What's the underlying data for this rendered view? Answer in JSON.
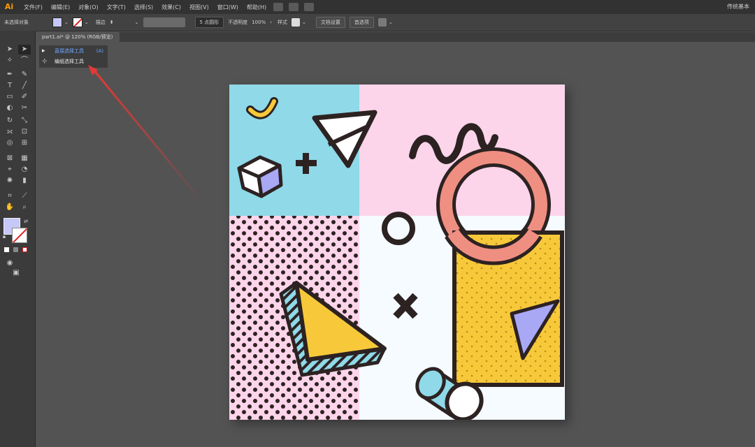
{
  "app": {
    "logo": "Ai",
    "workspace": "传统基本"
  },
  "menu": {
    "items": [
      "文件(F)",
      "编辑(E)",
      "对象(O)",
      "文字(T)",
      "选择(S)",
      "效果(C)",
      "视图(V)",
      "窗口(W)",
      "帮助(H)"
    ]
  },
  "control": {
    "selection_label": "未选择对象",
    "stroke_label": "描边",
    "stroke_value": "",
    "brush_value": "5 点圆形",
    "opacity_label": "不透明度",
    "opacity_value": "100%",
    "style_label": "样式",
    "doc_setup": "文档设置",
    "preferences": "首选项"
  },
  "doc": {
    "tab_title": "part1.ai* @ 120% (RGB/预览)"
  },
  "flyout": {
    "items": [
      {
        "icon": "direct-selection-icon",
        "label": "直接选择工具",
        "shortcut": "(A)",
        "selected": true
      },
      {
        "icon": "group-selection-icon",
        "label": "编组选择工具",
        "selected": false
      }
    ]
  },
  "colors": {
    "fill": "#c6c8f8",
    "accent_arrow": "#e53935",
    "art_cyan": "#8fd9e8",
    "art_pink": "#fcd5ea",
    "art_yellow": "#f7c93a",
    "art_salmon": "#ef8f82",
    "art_lavender": "#a8a8f5",
    "art_outline": "#2d2222"
  }
}
